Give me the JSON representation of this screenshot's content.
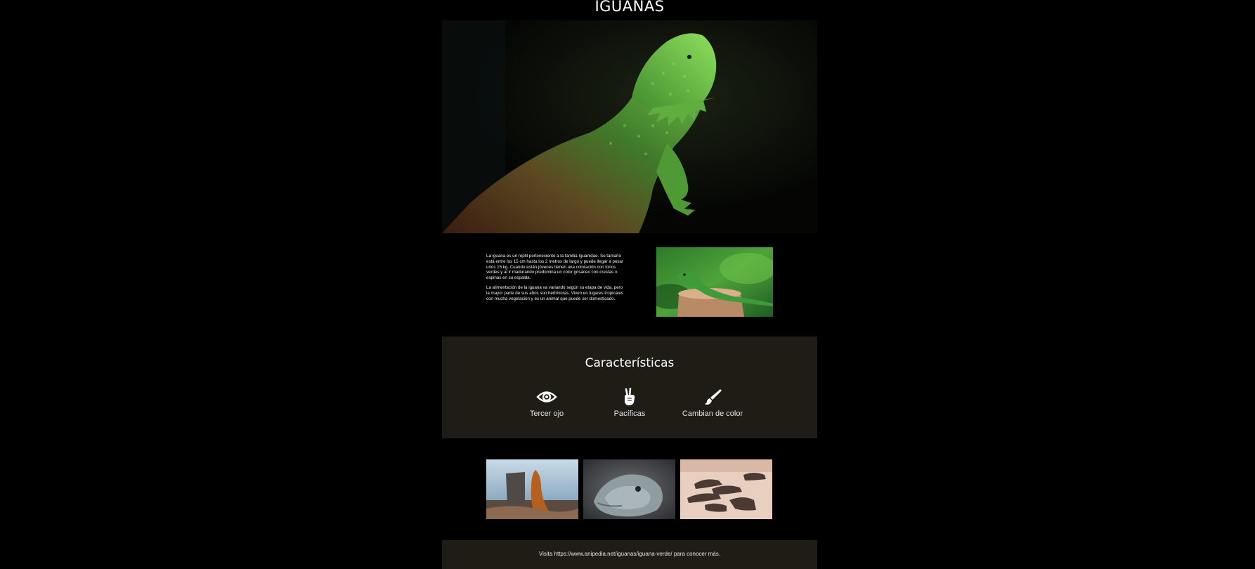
{
  "page": {
    "title": "IGUANAS"
  },
  "intro": {
    "paragraph_1": "La iguana es un reptil perteneciente a la familia Iguanidae. Su tamaño está entre los 15 cm hasta los 2 metros de largo y puede llegar a pesar unos 15 kg. Cuando están jóvenes tienen una coloración con tonos verdes y al ir madurando predomina un color grisáceo con crestas o espinas en su espalda.",
    "paragraph_2": "La alimentación de la iguana va variando según su etapa de vida, pero la mayor parte de sus años son herbívoras. Viven en lugares tropicales con mucha vegetación y es un animal que puede ser domesticado."
  },
  "features": {
    "heading": "Características",
    "items": [
      {
        "label": "Tercer ojo",
        "icon": "eye-icon"
      },
      {
        "label": "Pacíficas",
        "icon": "peace-hand-icon"
      },
      {
        "label": "Cambian de color",
        "icon": "paintbrush-icon"
      }
    ]
  },
  "footer": {
    "text": "Visita https://www.anipedia.net/iguanas/iguana-verde/ para conocer más."
  },
  "colors": {
    "background": "#000000",
    "section_background": "#1f1b15",
    "text": "#ffffff"
  }
}
